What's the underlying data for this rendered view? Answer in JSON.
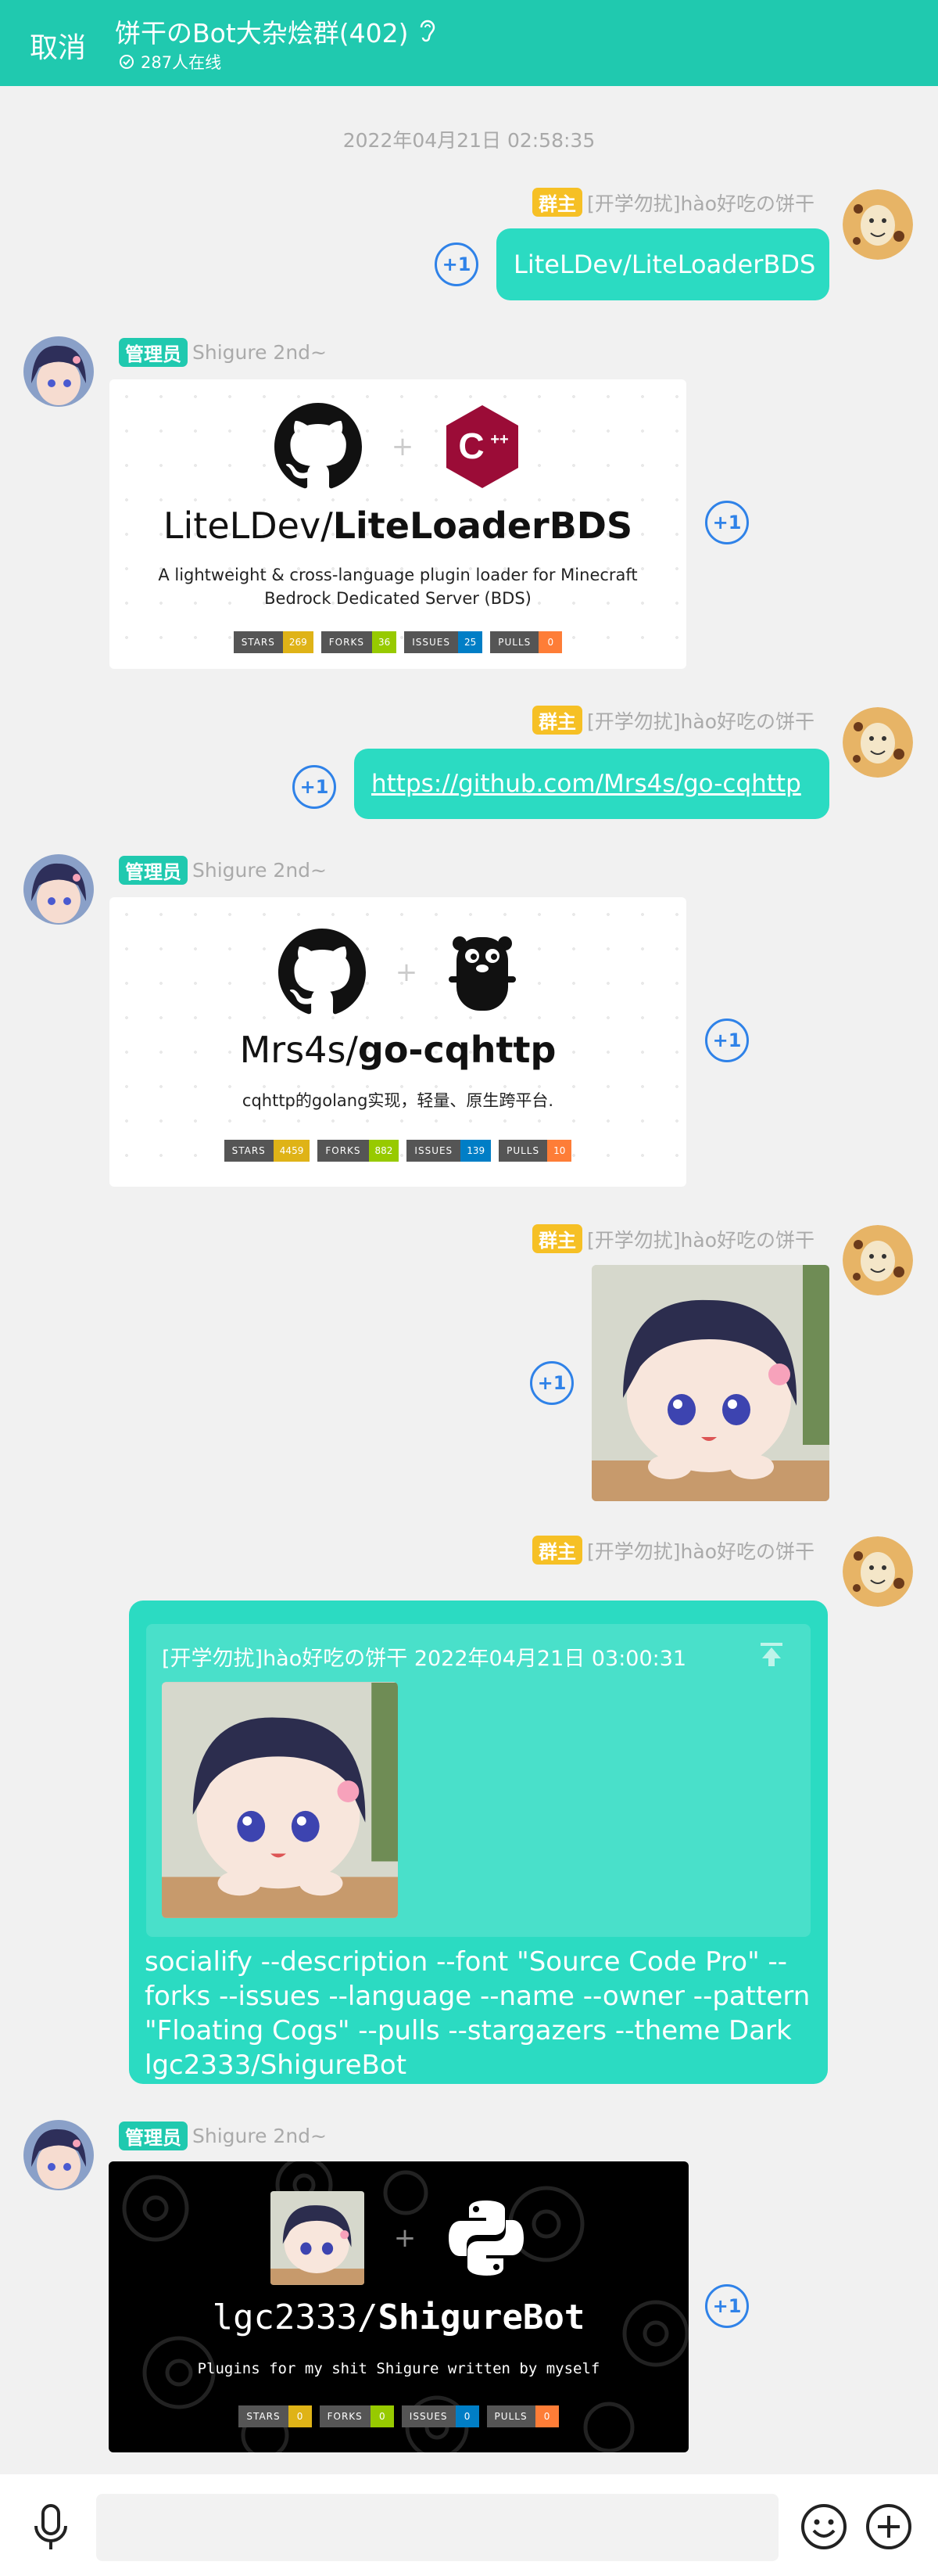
{
  "header": {
    "cancel_label": "取消",
    "title": "饼干のBot大杂烩群(402)",
    "online": "287人在线"
  },
  "timestamp": "2022年04月21日 02:58:35",
  "sender_owner": {
    "badge": "群主",
    "name": "[开学勿扰]hào好吃の饼干"
  },
  "sender_admin": {
    "badge": "管理员",
    "name": "Shigure 2nd~"
  },
  "plus_label": "+1",
  "messages": {
    "m1_text": "LiteLDev/LiteLoaderBDS",
    "m2_card": {
      "owner": "LiteLDev/",
      "repo": "LiteLoaderBDS",
      "desc": "A lightweight & cross-language plugin loader for Minecraft Bedrock Dedicated Server (BDS)",
      "stats": [
        {
          "k": "STARS",
          "v": "269",
          "color": "#dfb317"
        },
        {
          "k": "FORKS",
          "v": "36",
          "color": "#97ca00"
        },
        {
          "k": "ISSUES",
          "v": "25",
          "color": "#007ec6"
        },
        {
          "k": "PULLS",
          "v": "0",
          "color": "#fe7d37"
        }
      ]
    },
    "m3_link": "https://github.com/Mrs4s/go-cqhttp",
    "m4_card": {
      "owner": "Mrs4s/",
      "repo": "go-cqhttp",
      "desc": "cqhttp的golang实现，轻量、原生跨平台.",
      "stats": [
        {
          "k": "STARS",
          "v": "4459",
          "color": "#dfb317"
        },
        {
          "k": "FORKS",
          "v": "882",
          "color": "#97ca00"
        },
        {
          "k": "ISSUES",
          "v": "139",
          "color": "#007ec6"
        },
        {
          "k": "PULLS",
          "v": "10",
          "color": "#fe7d37"
        }
      ]
    },
    "m6_reply": {
      "quote_head": "[开学勿扰]hào好吃の饼干 2022年04月21日 03:00:31",
      "text": "socialify --description --font \"Source Code Pro\" --forks --issues --language --name --owner --pattern \"Floating Cogs\" --pulls --stargazers --theme Dark lgc2333/ShigureBot"
    },
    "m7_card": {
      "owner": "lgc2333/",
      "repo": "ShigureBot",
      "desc": "Plugins for my shit Shigure written by myself",
      "stats": [
        {
          "k": "STARS",
          "v": "0",
          "color": "#dfb317"
        },
        {
          "k": "FORKS",
          "v": "0",
          "color": "#97ca00"
        },
        {
          "k": "ISSUES",
          "v": "0",
          "color": "#007ec6"
        },
        {
          "k": "PULLS",
          "v": "0",
          "color": "#fe7d37"
        }
      ]
    }
  },
  "colors": {
    "accent": "#20c9af",
    "bubble": "#2bdbc2",
    "plus": "#2f82e8",
    "owner_badge": "#f6c025"
  },
  "icons": [
    "ear-icon",
    "online-check-icon",
    "github-icon",
    "cpp-icon",
    "gopher-icon",
    "python-icon",
    "pin-top-icon",
    "mic-icon",
    "emoji-icon",
    "add-icon"
  ]
}
